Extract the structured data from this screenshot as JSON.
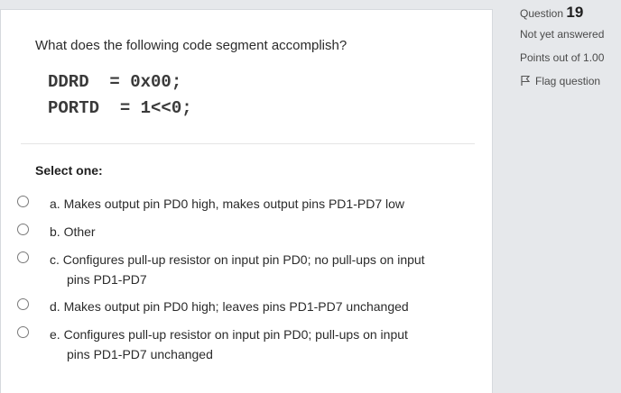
{
  "question": {
    "prompt": "What does the following code segment accomplish?",
    "code_lines": [
      "DDRD  = 0x00;",
      "PORTD  = 1<<0;"
    ],
    "select_label": "Select one:",
    "options": [
      {
        "letter": "a.",
        "text": "Makes output pin PD0 high, makes output pins PD1-PD7 low",
        "text2": ""
      },
      {
        "letter": "b.",
        "text": "Other",
        "text2": ""
      },
      {
        "letter": "c.",
        "text": "Configures pull-up resistor on input pin PD0; no pull-ups on input",
        "text2": "pins PD1-PD7"
      },
      {
        "letter": "d.",
        "text": "Makes output pin PD0 high; leaves pins PD1-PD7 unchanged",
        "text2": ""
      },
      {
        "letter": "e.",
        "text": "Configures pull-up resistor on input pin PD0; pull-ups on input",
        "text2": "pins PD1-PD7 unchanged"
      }
    ]
  },
  "info": {
    "question_label": "Question",
    "question_number": "19",
    "status": "Not yet answered",
    "points": "Points out of 1.00",
    "flag_label": "Flag question"
  },
  "colors": {
    "page_bg": "#e6e8eb",
    "card_bg": "#ffffff"
  },
  "icons": {
    "flag": "flag-icon",
    "radio": "radio-circle"
  }
}
